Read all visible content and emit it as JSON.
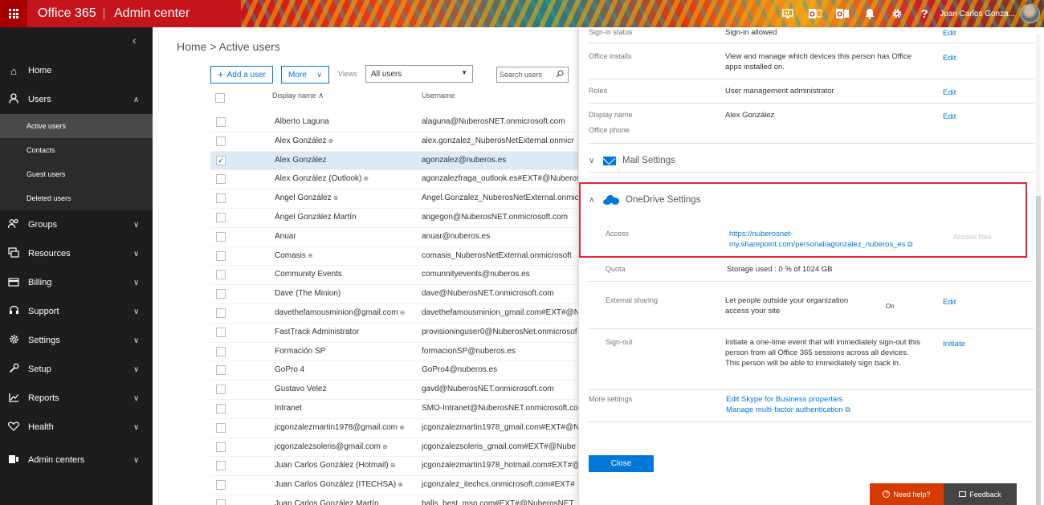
{
  "topbar": {
    "brand": "Office 365",
    "app_title": "Admin center",
    "user_name": "Juan Carlos Gonza...",
    "icons": [
      "monitor-icon",
      "outlook-icon",
      "office-icon",
      "bell-icon",
      "gear-icon",
      "help-icon"
    ]
  },
  "nav": {
    "collapse_glyph": "‹",
    "items": [
      {
        "id": "home",
        "label": "Home",
        "icon": "home-icon"
      },
      {
        "id": "users",
        "label": "Users",
        "icon": "person-icon"
      },
      {
        "id": "groups",
        "label": "Groups",
        "icon": "groups-icon"
      },
      {
        "id": "resources",
        "label": "Resources",
        "icon": "resources-icon"
      },
      {
        "id": "billing",
        "label": "Billing",
        "icon": "billing-icon"
      },
      {
        "id": "support",
        "label": "Support",
        "icon": "headset-icon"
      },
      {
        "id": "settings",
        "label": "Settings",
        "icon": "gear-icon"
      },
      {
        "id": "setup",
        "label": "Setup",
        "icon": "wrench-icon"
      },
      {
        "id": "reports",
        "label": "Reports",
        "icon": "chart-icon"
      },
      {
        "id": "health",
        "label": "Health",
        "icon": "heart-icon"
      },
      {
        "id": "admin_centers",
        "label": "Admin centers",
        "icon": "admin-centers-icon"
      }
    ],
    "users_sub": [
      {
        "label": "Active users",
        "active": true
      },
      {
        "label": "Contacts",
        "active": false
      },
      {
        "label": "Guest users",
        "active": false
      },
      {
        "label": "Deleted users",
        "active": false
      }
    ]
  },
  "main": {
    "breadcrumb": "Home > Active users",
    "add_user_label": "Add a user",
    "more_label": "More",
    "views_label": "Views",
    "views_value": "All users",
    "search_placeholder": "Search users",
    "col_display_name": "Display name",
    "col_username": "Username",
    "rows": [
      {
        "display": "Alberto Laguna",
        "ext": false,
        "username": "alaguna@NuberosNET.onmicrosoft.com",
        "selected": false
      },
      {
        "display": "Alex González",
        "ext": true,
        "username": "alex.gonzalez_NuberosNetExternal.onmicr",
        "selected": false
      },
      {
        "display": "Alex González",
        "ext": false,
        "username": "agonzalez@nuberos.es",
        "selected": true
      },
      {
        "display": "Alex González (Outlook)",
        "ext": true,
        "username": "agonzalezfraga_outlook.es#EXT#@Nuberos",
        "selected": false
      },
      {
        "display": "Angel González",
        "ext": true,
        "username": "Angel.Gonzalez_NuberosNetExternal.onmic",
        "selected": false
      },
      {
        "display": "Ángel González Martín",
        "ext": false,
        "username": "angegon@NuberosNET.onmicrosoft.com",
        "selected": false
      },
      {
        "display": "Anuar",
        "ext": false,
        "username": "anuar@nuberos.es",
        "selected": false
      },
      {
        "display": "Comasis",
        "ext": true,
        "username": "comasis_NuberosNetExternal.onmicrosoft",
        "selected": false
      },
      {
        "display": "Community Events",
        "ext": false,
        "username": "comunnityevents@nuberos.es",
        "selected": false
      },
      {
        "display": "Dave (The Minion)",
        "ext": false,
        "username": "dave@NuberosNET.onmicrosoft.com",
        "selected": false
      },
      {
        "display": "davethefamousminion@gmail.com",
        "ext": true,
        "username": "davethefamousminion_gmail.com#EXT#@N",
        "selected": false
      },
      {
        "display": "FastTrack Administrator",
        "ext": false,
        "username": "provisioninguser0@NuberosNet.onmicrosof",
        "selected": false
      },
      {
        "display": "Formación SP",
        "ext": false,
        "username": "formacionSP@nuberos.es",
        "selected": false
      },
      {
        "display": "GoPro 4",
        "ext": false,
        "username": "GoPro4@nuberos.es",
        "selected": false
      },
      {
        "display": "Gustavo Velez",
        "ext": false,
        "username": "gavd@NuberosNET.onmicrosoft.com",
        "selected": false
      },
      {
        "display": "Intranet",
        "ext": false,
        "username": "SMO-Intranet@NuberosNET.onmicrosoft.com",
        "selected": false
      },
      {
        "display": "jcgonzalezmartin1978@gmail.com",
        "ext": true,
        "username": "jcgonzalezmartin1978_gmail.com#EXT#@N",
        "selected": false
      },
      {
        "display": "jcgonzalezsoleris@gmail.com",
        "ext": true,
        "username": "jcgonzalezsoleris_gmail.com#EXT#@Nube",
        "selected": false
      },
      {
        "display": "Juan Carlos González (Hotmail)",
        "ext": true,
        "username": "jcgonzalezmartin1978_hotmail.com#EXT#@",
        "selected": false
      },
      {
        "display": "Juan Carlos González (ITECHSA)",
        "ext": true,
        "username": "jcgonzalez_itechcs.onmicrosoft.com#EXT#",
        "selected": false
      },
      {
        "display": "Juan Carlos González Martín",
        "ext": false,
        "username": "balls_best_msp.com#EXT#@NuberosNET",
        "selected": false
      }
    ]
  },
  "panel": {
    "signin_label": "Sign-in status",
    "signin_value": "Sign-in allowed",
    "office_label": "Office installs",
    "office_value": "View and manage which devices this person has Office apps installed on.",
    "roles_label": "Roles",
    "roles_value": "User management administrator",
    "display_label": "Display name",
    "phone_label": "Office phone",
    "display_value": "Alex González",
    "edit": "Edit",
    "mail_title": "Mail Settings",
    "onedrive_title": "OneDrive Settings",
    "access_label": "Access",
    "access_link_1": "https://nuberosnet-",
    "access_link_2": "my.sharepoint.com/personal/agonzalez_nuberos_es",
    "access_files": "Access files",
    "quota_label": "Quota",
    "quota_value": "Storage used : 0 % of 1024 GB",
    "sharing_label": "External sharing",
    "sharing_value": "Let people outside your organization access your site",
    "sharing_state": "On",
    "signout_label": "Sign-out",
    "signout_value": "Initiate a one-time event that will immediately sign-out this person from all Office 365 sessions across all devices. This person will be able to immediately sign back in.",
    "initiate": "Initiate",
    "more_label": "More settings",
    "more_link_1": "Edit Skype for Business properties",
    "more_link_2": "Manage multi-factor authentication",
    "close": "Close"
  },
  "help": {
    "need_help": "Need help?",
    "feedback": "Feedback"
  }
}
